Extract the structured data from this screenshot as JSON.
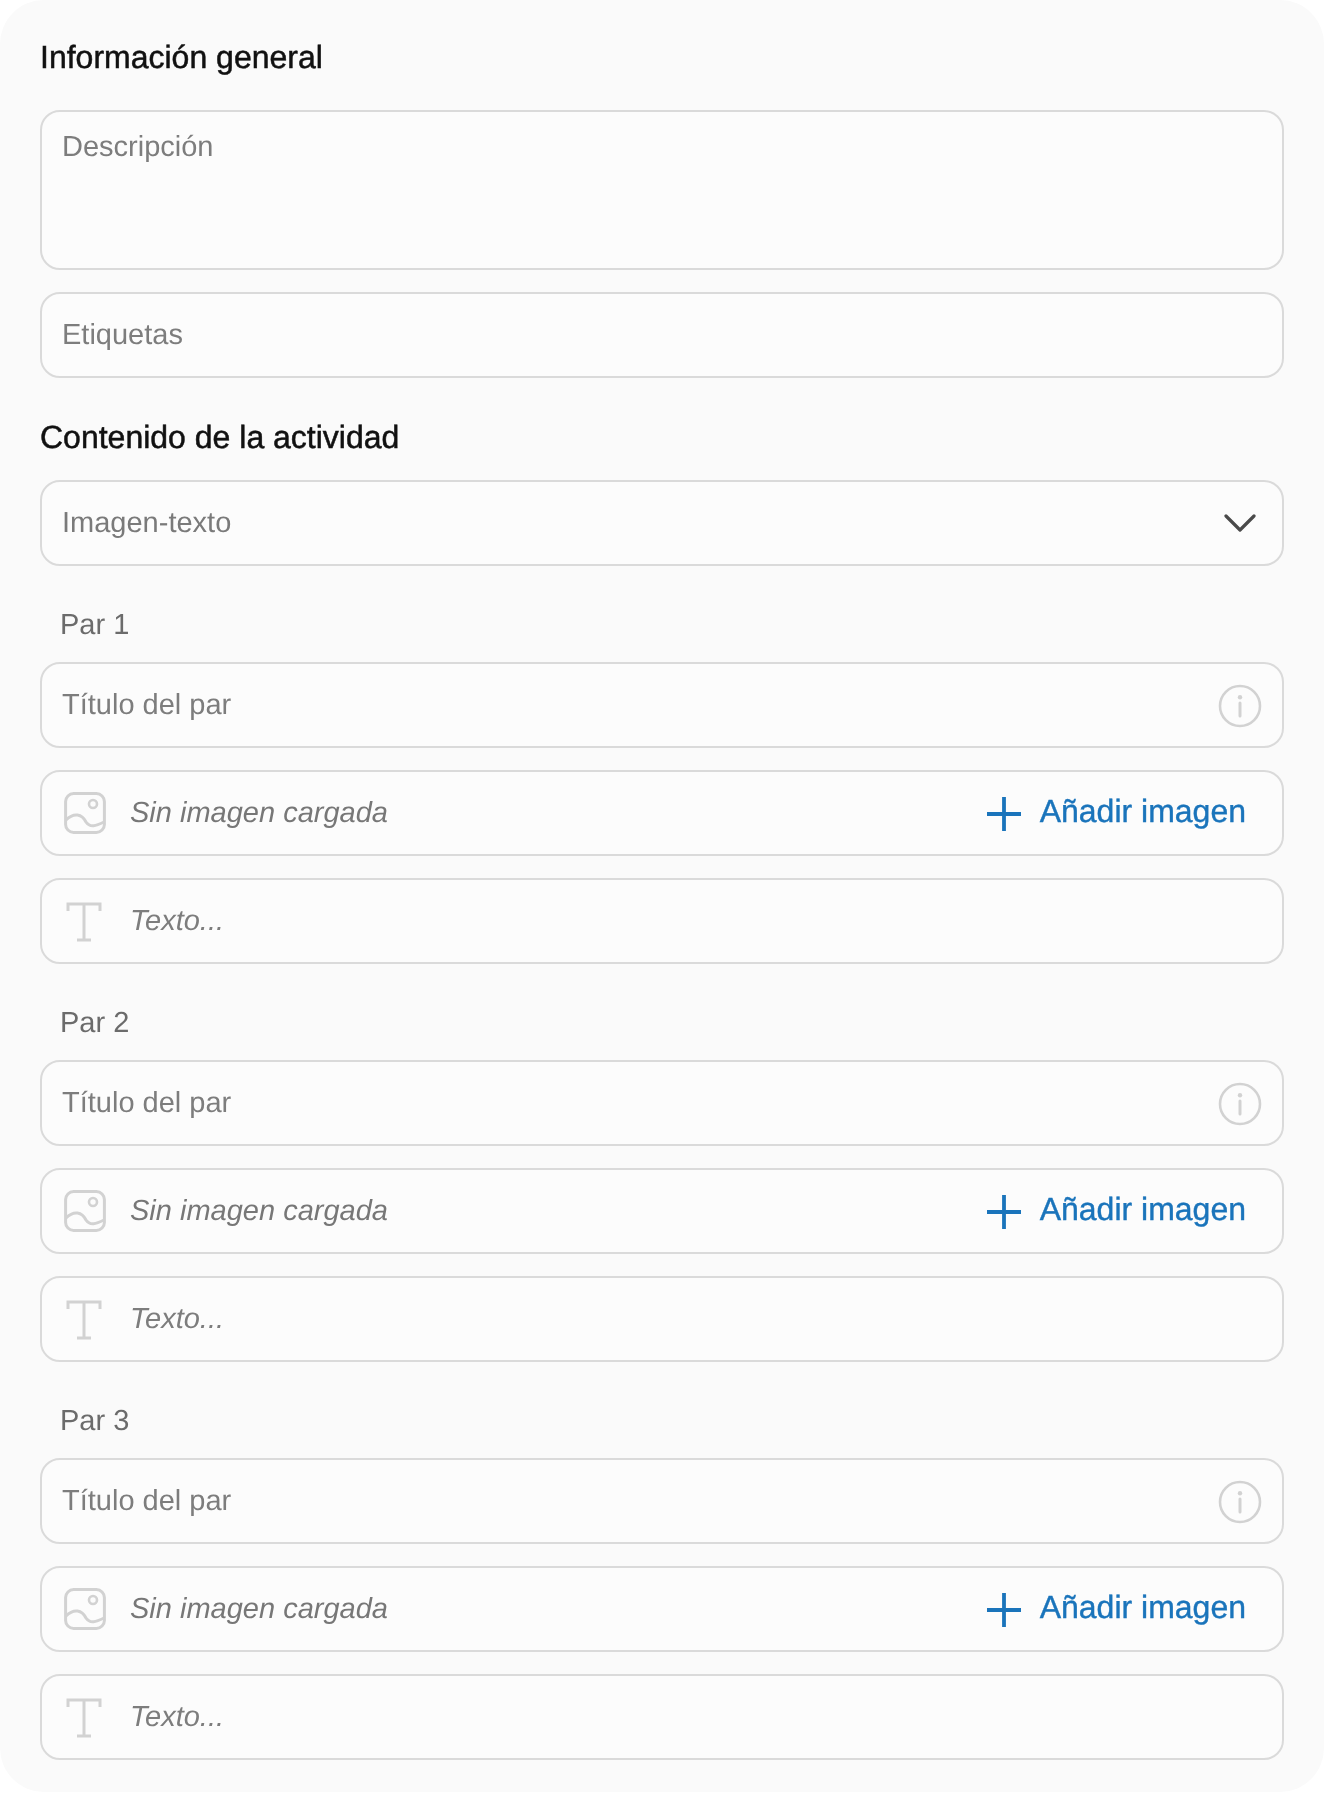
{
  "general": {
    "title": "Información general",
    "description": {
      "placeholder": "Descripción"
    },
    "tags": {
      "placeholder": "Etiquetas"
    }
  },
  "content": {
    "title": "Contenido de la actividad",
    "type_select": {
      "value": "Imagen-texto"
    },
    "pairs": [
      {
        "label": "Par 1",
        "title": {
          "placeholder": "Título del par"
        },
        "image": {
          "status": "Sin imagen cargada",
          "button": "Añadir imagen"
        },
        "text": {
          "placeholder": "Texto..."
        }
      },
      {
        "label": "Par 2",
        "title": {
          "placeholder": "Título del par"
        },
        "image": {
          "status": "Sin imagen cargada",
          "button": "Añadir imagen"
        },
        "text": {
          "placeholder": "Texto..."
        }
      },
      {
        "label": "Par 3",
        "title": {
          "placeholder": "Título del par"
        },
        "image": {
          "status": "Sin imagen cargada",
          "button": "Añadir imagen"
        },
        "text": {
          "placeholder": "Texto..."
        }
      }
    ]
  }
}
